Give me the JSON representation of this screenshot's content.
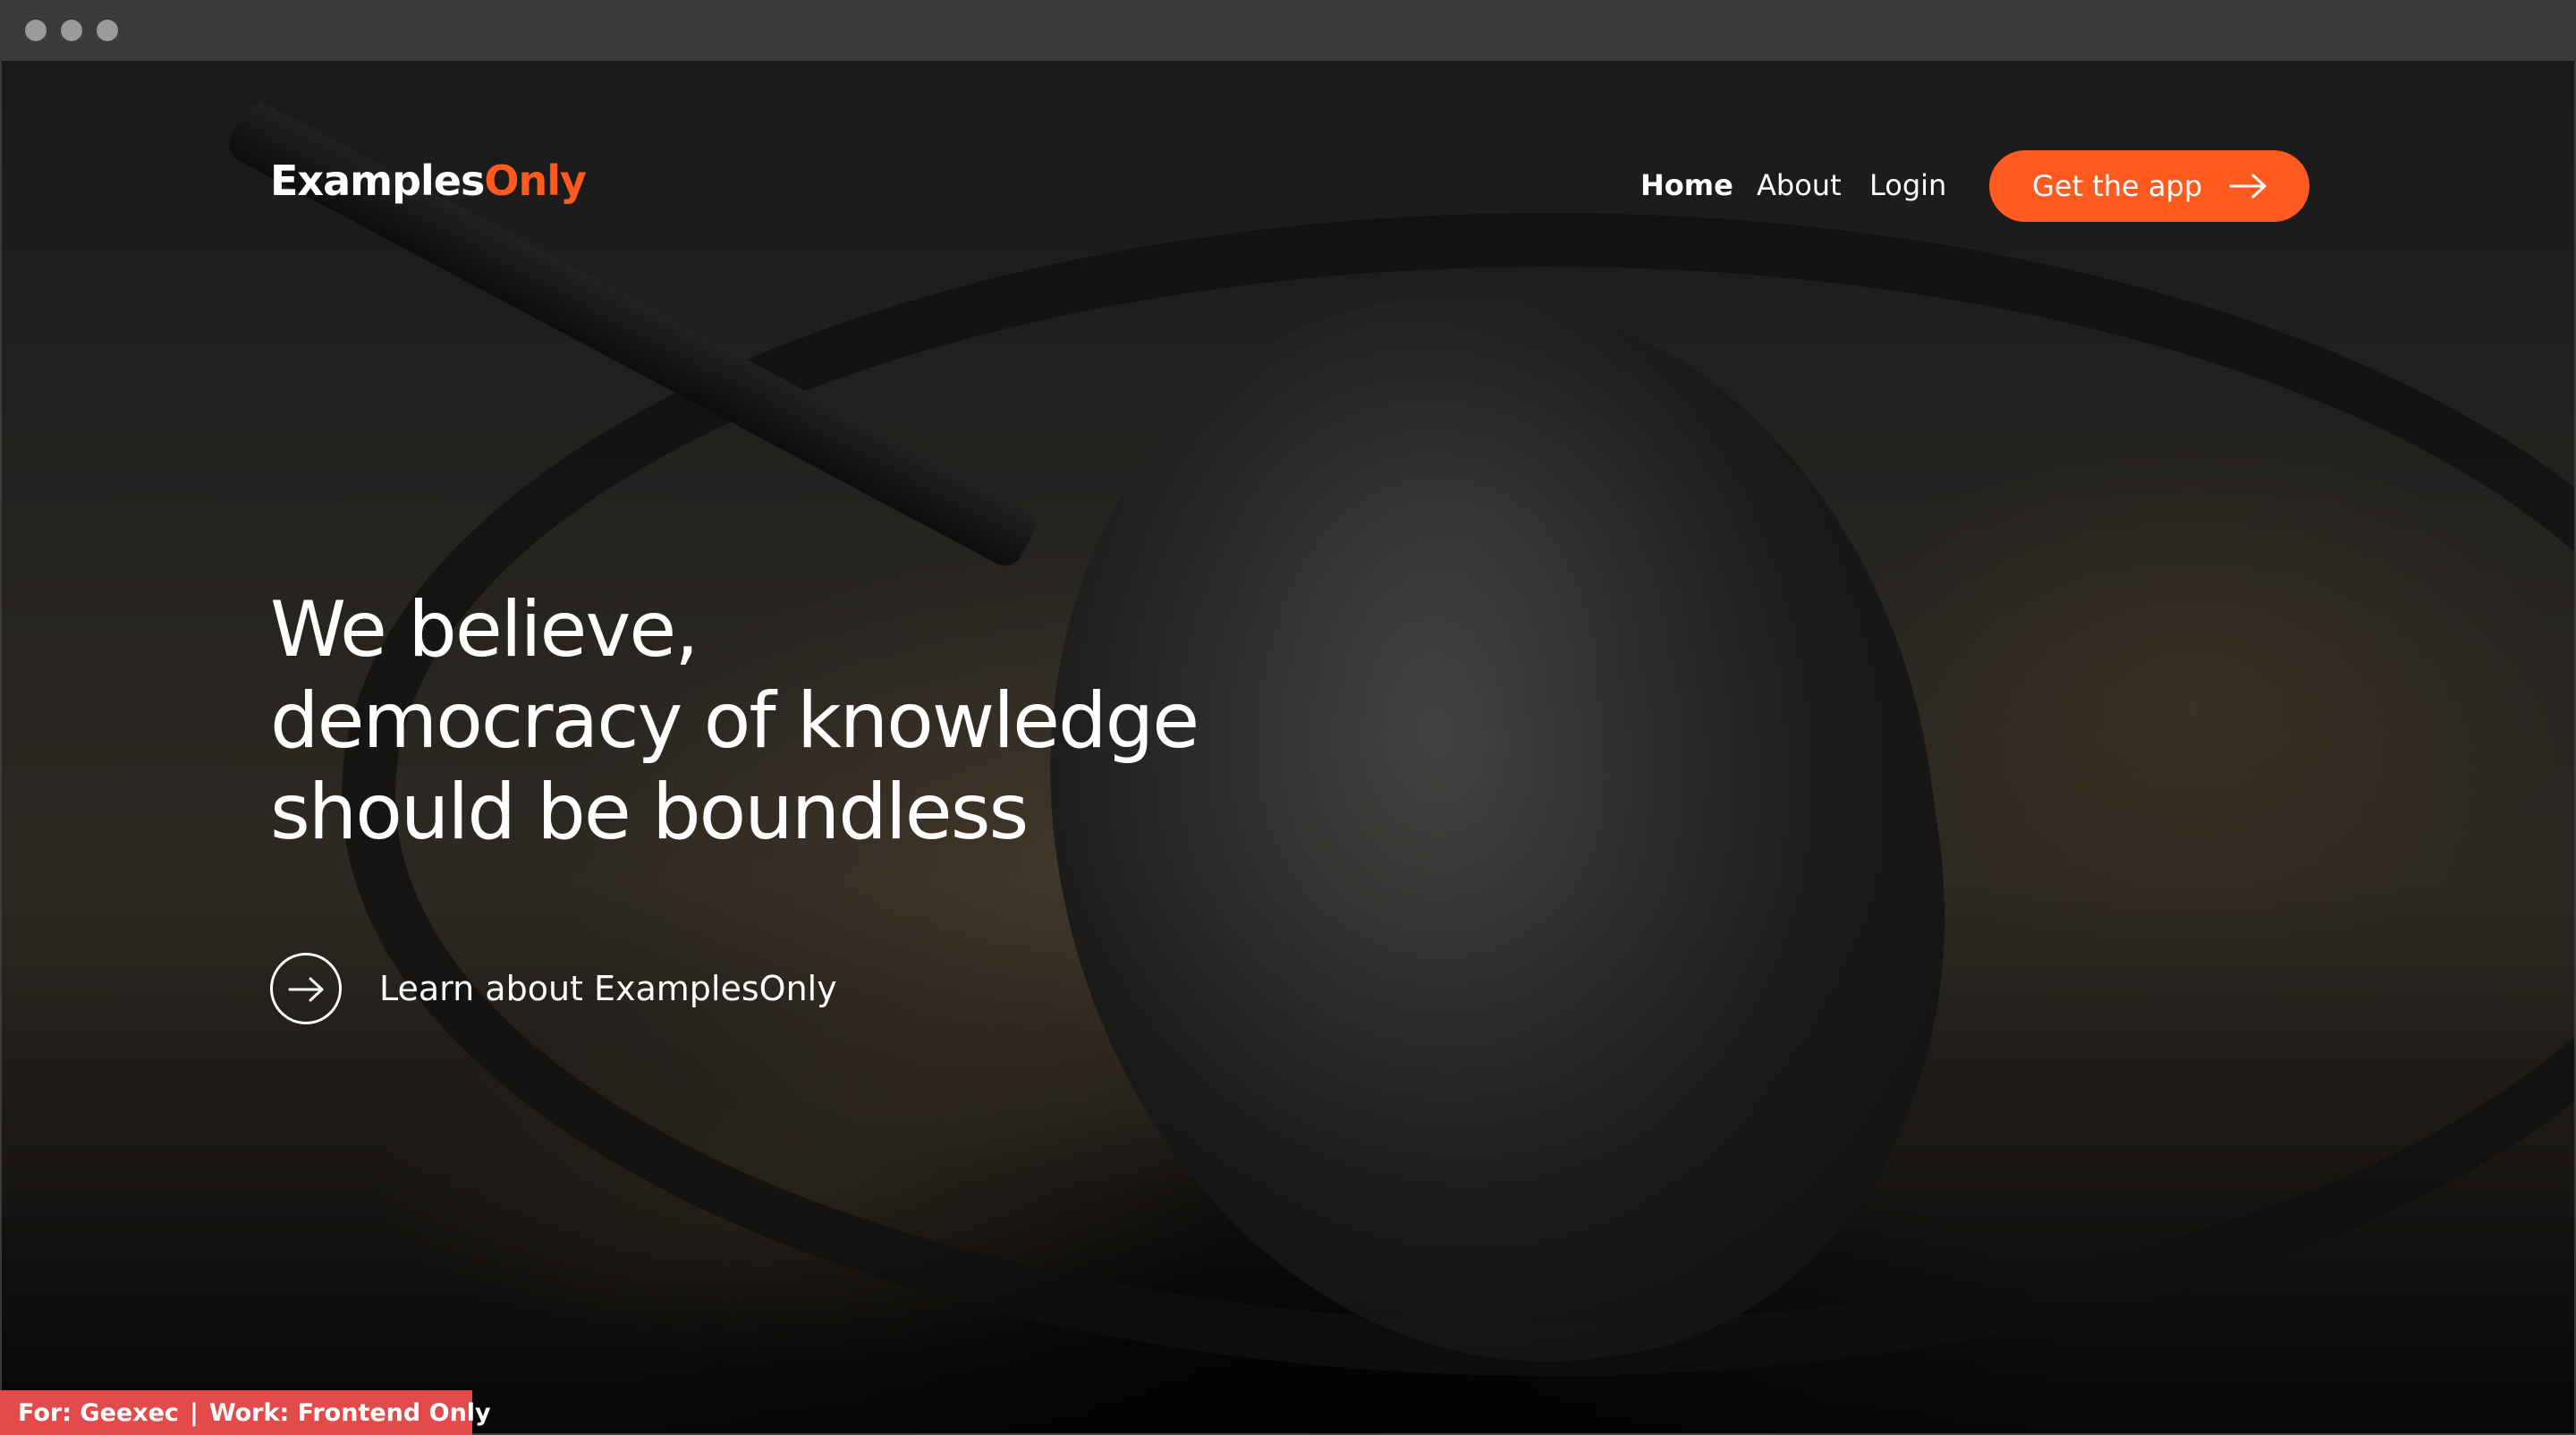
{
  "window": {
    "traffic_lights": [
      "close",
      "minimize",
      "maximize"
    ],
    "traffic_color": "#9a9b9d",
    "chrome_color": "#3a3b3d"
  },
  "header": {
    "brand_part1": "Examples",
    "brand_part2": "Only",
    "nav": {
      "home": "Home",
      "about": "About",
      "login": "Login"
    },
    "cta_label": "Get the app"
  },
  "hero": {
    "headline_line1": "We believe,",
    "headline_line2": "democracy of knowledge",
    "headline_line3": "should be boundless",
    "learn_label": "Learn about ExamplesOnly",
    "background_image": "wok-cooking-fried-rice"
  },
  "footer_badge": {
    "for_text": "For: Geexec",
    "separator": "|",
    "work_text": "Work: Frontend Only"
  },
  "colors": {
    "accent": "#ff5a1f",
    "badge": "#e34b4b",
    "text": "#ffffff"
  },
  "icons": {
    "cta_icon": "arrow-right-icon",
    "learn_icon": "arrow-right-circle-icon"
  }
}
